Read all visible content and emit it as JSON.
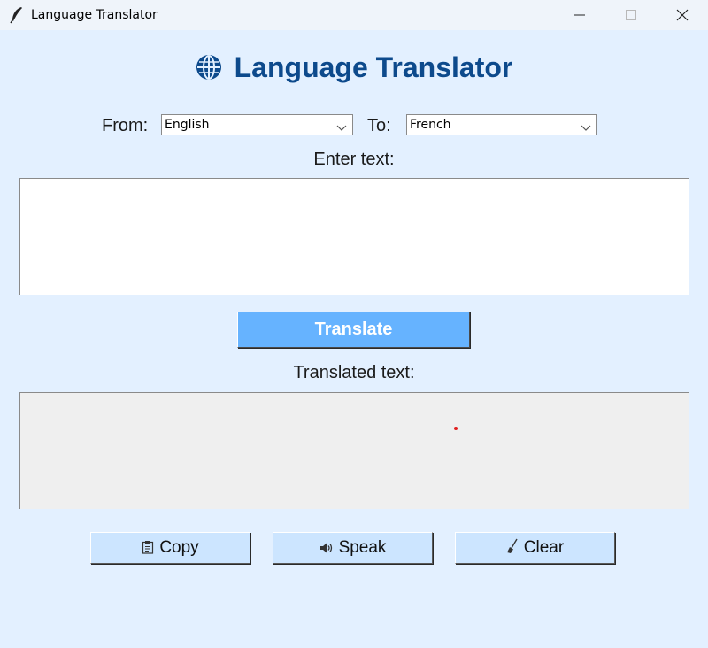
{
  "window": {
    "title": "Language Translator",
    "icons": {
      "app": "feather-icon",
      "minimize": "minimize-icon",
      "maximize": "maximize-icon",
      "close": "close-icon"
    }
  },
  "header": {
    "title": "Language Translator",
    "icon": "globe-icon"
  },
  "languages": {
    "from_label": "From:",
    "from_value": "English",
    "to_label": "To:",
    "to_value": "French"
  },
  "input": {
    "label": "Enter text:",
    "value": ""
  },
  "translate_button": {
    "label": "Translate"
  },
  "output": {
    "label": "Translated text:",
    "value": ""
  },
  "actions": {
    "copy": {
      "label": "Copy",
      "icon": "clipboard-icon"
    },
    "speak": {
      "label": "Speak",
      "icon": "speaker-icon"
    },
    "clear": {
      "label": "Clear",
      "icon": "broom-icon"
    }
  },
  "colors": {
    "background": "#e3f0ff",
    "heading": "#0d4a8c",
    "translate_button": "#66b3ff",
    "action_button": "#cce5ff",
    "output_background": "#efefef"
  }
}
